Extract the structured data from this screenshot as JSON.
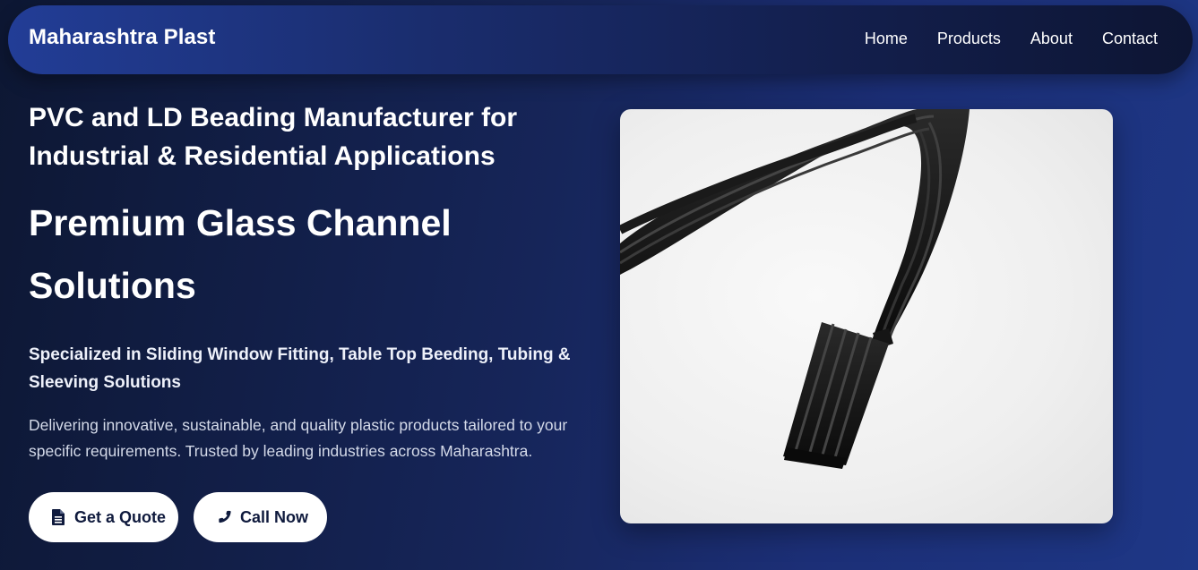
{
  "nav": {
    "brand": "Maharashtra Plast",
    "links": [
      {
        "label": "Home"
      },
      {
        "label": "Products"
      },
      {
        "label": "About"
      },
      {
        "label": "Contact"
      }
    ]
  },
  "hero": {
    "subheading": "PVC and LD Beading Manufacturer for Industrial & Residential Applications",
    "title": "Premium Glass Channel Solutions",
    "specialization": "Specialized in Sliding Window Fitting, Table Top Beeding, Tubing & Sleeving Solutions",
    "description": "Delivering innovative, sustainable, and quality plastic products tailored to your specific requirements. Trusted by leading industries across Maharashtra.",
    "buttons": {
      "quote_label": "Get a Quote",
      "quote_icon": "file-icon",
      "call_label": "Call Now",
      "call_icon": "phone-icon"
    },
    "image_subject": "black-rubber-glass-channel-beading"
  },
  "colors": {
    "background_dark": "#0d1733",
    "background_blue": "#1e3786",
    "nav_gradient_start": "#223d96",
    "button_bg": "#ffffff",
    "button_text": "#0f1a3d"
  }
}
